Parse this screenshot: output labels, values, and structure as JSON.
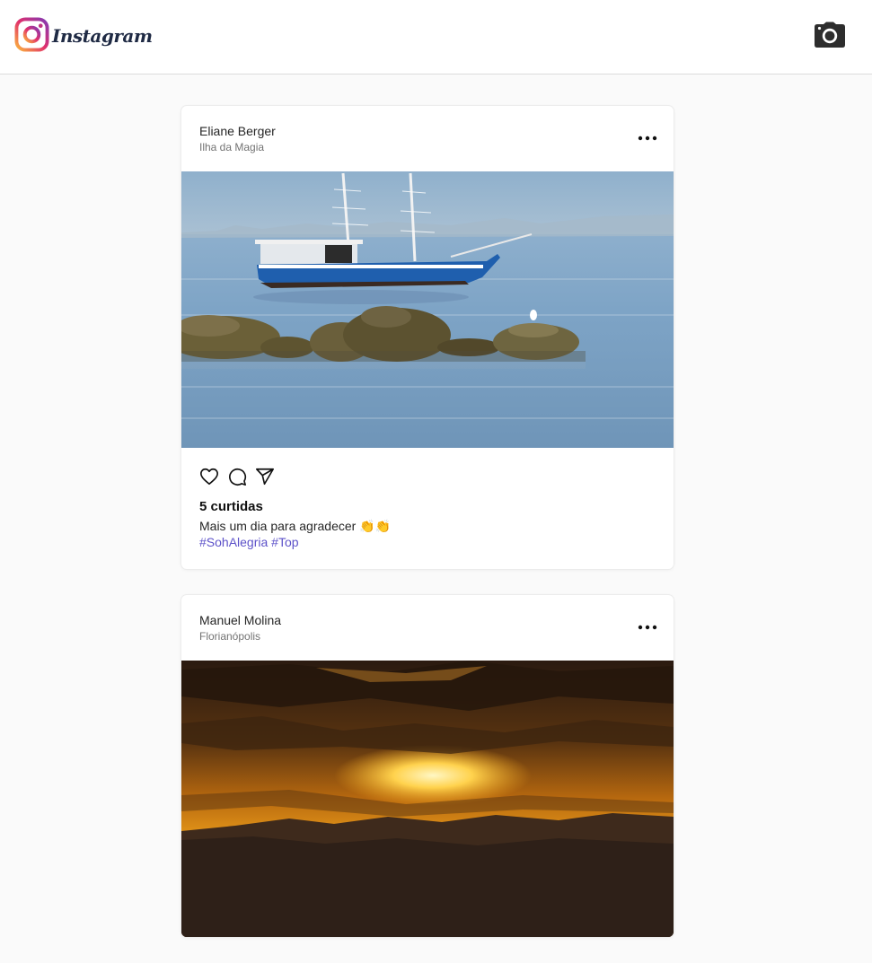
{
  "app": {
    "brand_name": "Instagram",
    "logo_icon": "instagram-logo-icon",
    "camera_icon": "camera-icon",
    "colors": {
      "background": "#fafafa",
      "card": "#ffffff",
      "hashtag": "#5d52c9",
      "logo_gradient": [
        "#fbb33d",
        "#e1306c",
        "#833ab4"
      ]
    }
  },
  "posts": [
    {
      "user": "Eliane Berger",
      "location": "Ilha da Magia",
      "image": "sailboat-at-sea-with-rocks",
      "likes": "5 curtidas",
      "caption": "Mais um dia para agradecer 👏👏",
      "hashtags": [
        "#SohAlegria",
        "#Top"
      ],
      "icons": [
        "more-options-icon",
        "heart-icon",
        "comment-icon",
        "share-icon"
      ]
    },
    {
      "user": "Manuel Molina",
      "location": "Florianópolis",
      "image": "sunset-over-mountains",
      "icons": [
        "more-options-icon"
      ]
    }
  ]
}
